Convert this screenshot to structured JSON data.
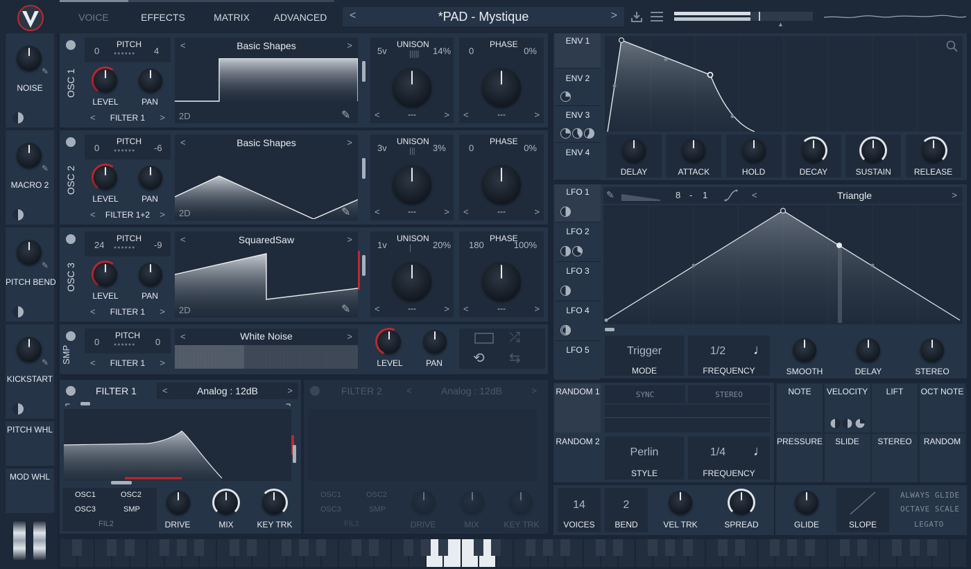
{
  "header": {
    "tabs": [
      "VOICE",
      "EFFECTS",
      "MATRIX",
      "ADVANCED"
    ],
    "preset_name": "*PAD - Mystique",
    "prev": "<",
    "next": ">"
  },
  "left_macros": [
    {
      "label": "NOISE"
    },
    {
      "label": "MACRO 2"
    },
    {
      "label": "PITCH BEND"
    },
    {
      "label": "KICKSTART"
    },
    {
      "label": "PITCH WHL"
    },
    {
      "label": "MOD WHL"
    }
  ],
  "oscillators": [
    {
      "name": "OSC 1",
      "pitch_label": "PITCH",
      "pitch_left": "0",
      "pitch_right": "4",
      "level": "LEVEL",
      "pan": "PAN",
      "filter": "FILTER 1",
      "wavetable": "Basic Shapes",
      "dim_label": "2D",
      "unison_label": "UNISON",
      "voices": "5v",
      "detune": "14%",
      "phase_label": "PHASE",
      "phase": "0",
      "phase_rand": "0%",
      "dest_left": "---",
      "dest_right": "---"
    },
    {
      "name": "OSC 2",
      "pitch_label": "PITCH",
      "pitch_left": "0",
      "pitch_right": "-6",
      "level": "LEVEL",
      "pan": "PAN",
      "filter": "FILTER 1+2",
      "wavetable": "Basic Shapes",
      "dim_label": "2D",
      "unison_label": "UNISON",
      "voices": "3v",
      "detune": "3%",
      "phase_label": "PHASE",
      "phase": "0",
      "phase_rand": "0%",
      "dest_left": "---",
      "dest_right": "---"
    },
    {
      "name": "OSC 3",
      "pitch_label": "PITCH",
      "pitch_left": "24",
      "pitch_right": "-9",
      "level": "LEVEL",
      "pan": "PAN",
      "filter": "FILTER 1",
      "wavetable": "SquaredSaw",
      "dim_label": "2D",
      "unison_label": "UNISON",
      "voices": "1v",
      "detune": "20%",
      "phase_label": "PHASE",
      "phase": "180",
      "phase_rand": "100%",
      "dest_left": "---",
      "dest_right": "---"
    }
  ],
  "sampler": {
    "name": "SMP",
    "pitch_label": "PITCH",
    "pitch_left": "0",
    "pitch_right": "0",
    "filter": "FILTER 1",
    "sample": "White Noise",
    "level": "LEVEL",
    "pan": "PAN"
  },
  "filter1": {
    "title": "FILTER 1",
    "model": "Analog : 12dB",
    "src": [
      "OSC1",
      "OSC2",
      "OSC3",
      "SMP"
    ],
    "fil2": "FIL2",
    "drive": "DRIVE",
    "mix": "MIX",
    "keytrk": "KEY TRK"
  },
  "filter2": {
    "title": "FILTER 2",
    "model": "Analog : 12dB",
    "src": [
      "OSC1",
      "OSC2",
      "OSC3",
      "SMP"
    ],
    "fil1": "FIL1",
    "drive": "DRIVE",
    "mix": "MIX",
    "keytrk": "KEY TRK"
  },
  "envelopes": {
    "tabs": [
      "ENV 1",
      "ENV 2",
      "ENV 3",
      "ENV 4"
    ],
    "knobs": [
      "DELAY",
      "ATTACK",
      "HOLD",
      "DECAY",
      "SUSTAIN",
      "RELEASE"
    ]
  },
  "lfos": {
    "tabs": [
      "LFO 1",
      "LFO 2",
      "LFO 3",
      "LFO 4",
      "LFO 5"
    ],
    "grid_x": "8",
    "grid_sep": "-",
    "grid_y": "1",
    "shape": "Triangle",
    "mode_value": "Trigger",
    "mode_label": "MODE",
    "freq_value": "1/2",
    "freq_label": "FREQUENCY",
    "knobs": [
      "SMOOTH",
      "DELAY",
      "STEREO"
    ]
  },
  "random": {
    "tabs": [
      "RANDOM 1",
      "RANDOM 2"
    ],
    "sync": "SYNC",
    "stereo": "STEREO",
    "style_value": "Perlin",
    "style_label": "STYLE",
    "freq_value": "1/4",
    "freq_label": "FREQUENCY"
  },
  "mod_sources": [
    "NOTE",
    "VELOCITY",
    "LIFT",
    "OCT NOTE",
    "PRESSURE",
    "SLIDE",
    "STEREO",
    "RANDOM"
  ],
  "voice": {
    "voices_value": "14",
    "voices_label": "VOICES",
    "bend_value": "2",
    "bend_label": "BEND",
    "veltrk": "VEL TRK",
    "spread": "SPREAD",
    "glide": "GLIDE",
    "slope": "SLOPE",
    "options": [
      "ALWAYS GLIDE",
      "OCTAVE SCALE",
      "LEGATO"
    ]
  },
  "colors": {
    "accent": "#c0272d",
    "panel": "#263447",
    "bg": "#1a2535"
  }
}
